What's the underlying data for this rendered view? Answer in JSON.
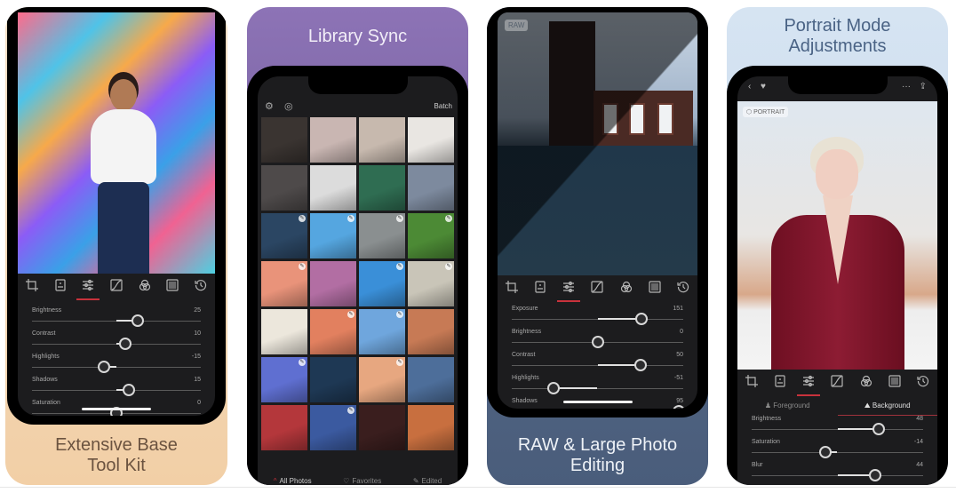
{
  "cards": [
    {
      "caption": "Extensive Base Tool Kit",
      "caption_lines": [
        "Extensive Base",
        "Tool Kit"
      ],
      "toolbar": [
        "crop",
        "frame",
        "adjust",
        "curves",
        "color-mixer",
        "vignette",
        "history"
      ],
      "active_tool": "adjust",
      "sliders": [
        {
          "label": "Brightness",
          "value": "25",
          "level": 25
        },
        {
          "label": "Contrast",
          "value": "10",
          "level": 10
        },
        {
          "label": "Highlights",
          "value": "-15",
          "level": -15
        },
        {
          "label": "Shadows",
          "value": "15",
          "level": 15
        },
        {
          "label": "Saturation",
          "value": "0",
          "level": 0
        }
      ]
    },
    {
      "caption": "Library Sync",
      "header": {
        "settings_icon": "gear-icon",
        "sync_icon": "aperture-icon",
        "batch_label": "Batch"
      },
      "grid_colors": [
        "#3a3431",
        "#c9b6b2",
        "#c7b9ae",
        "#e9e6e2",
        "#4e4a4a",
        "#dcdcdc",
        "#2f6d52",
        "#7d8a9e",
        "#2b4663",
        "#55a6e0",
        "#8a8f90",
        "#4c8a35",
        "#e9937a",
        "#b26ea3",
        "#3a8fd8",
        "#c9c5b8",
        "#ece7dc",
        "#e2805f",
        "#6fa6dd",
        "#c77a55",
        "#5f6fd1",
        "#1e3854",
        "#e7a780",
        "#4d6e9a",
        "#b4373b",
        "#3b5aa0",
        "#3a1e1e",
        "#c86f3f"
      ],
      "edited_thumbs": [
        8,
        9,
        10,
        11,
        12,
        14,
        15,
        17,
        18,
        20,
        22,
        25
      ],
      "tabs": [
        {
          "label": "All Photos",
          "icon": "chevron-up-icon",
          "active": true
        },
        {
          "label": "Favorites",
          "icon": "heart-icon",
          "active": false
        },
        {
          "label": "Edited",
          "icon": "pencil-icon",
          "active": false
        }
      ]
    },
    {
      "caption": "RAW & Large Photo Editing",
      "caption_lines": [
        "RAW & Large Photo",
        "Editing"
      ],
      "badge": "RAW",
      "toolbar": [
        "crop",
        "frame",
        "adjust",
        "curves",
        "color-mixer",
        "vignette",
        "history"
      ],
      "active_tool": "adjust",
      "sliders": [
        {
          "label": "Exposure",
          "value": "151",
          "level": 51
        },
        {
          "label": "Brightness",
          "value": "0",
          "level": 0
        },
        {
          "label": "Contrast",
          "value": "50",
          "level": 50
        },
        {
          "label": "Highlights",
          "value": "-51",
          "level": -51
        },
        {
          "label": "Shadows",
          "value": "95",
          "level": 95
        }
      ]
    },
    {
      "caption": "Portrait Mode Adjustments",
      "caption_lines": [
        "Portrait Mode",
        "Adjustments"
      ],
      "badge": "PORTRAIT",
      "nav": {
        "back": "‹",
        "favorite": "♥",
        "more": "···",
        "share": "⇪"
      },
      "toolbar": [
        "crop",
        "frame",
        "adjust",
        "curves",
        "color-mixer",
        "vignette",
        "history"
      ],
      "active_tool": "adjust",
      "segments": [
        {
          "label": "Foreground",
          "active": false
        },
        {
          "label": "Background",
          "active": true
        }
      ],
      "sliders": [
        {
          "label": "Brightness",
          "value": "48",
          "level": 48
        },
        {
          "label": "Saturation",
          "value": "-14",
          "level": -14
        },
        {
          "label": "Blur",
          "value": "44",
          "level": 44
        }
      ]
    }
  ],
  "colors": {
    "accent": "#c8323c",
    "card1_bg": "#f2cfa6",
    "card2_bg": "#8d73b6",
    "card3_bg": "#4a5d7b",
    "card4_bg": "#d6e4f2"
  }
}
